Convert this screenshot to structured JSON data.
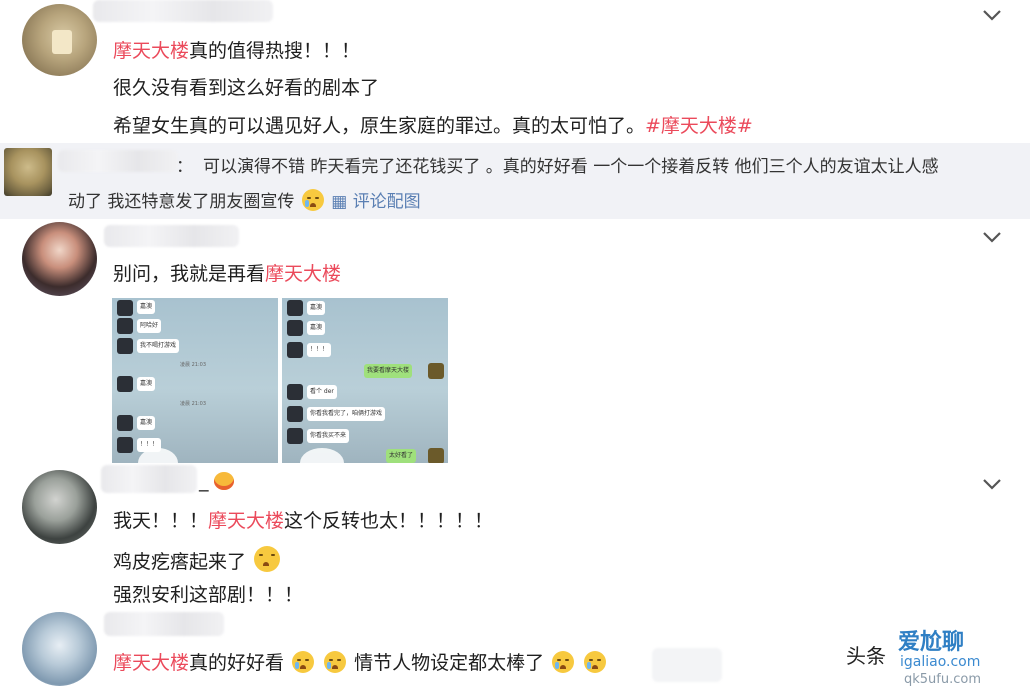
{
  "comments": [
    {
      "highlight": "摩天大楼",
      "line1_rest": "真的值得热搜！！！",
      "line2": "很久没有看到这么好看的剧本了",
      "line3_pre": "希望女生真的可以遇见好人，原生家庭的罪过。真的太可怕了。",
      "hashtag": "#摩天大楼#"
    },
    {
      "line1_pre": "别问，我就是再看",
      "highlight": "摩天大楼"
    },
    {
      "line1_pre": "我天！！！",
      "highlight": "摩天大楼",
      "line1_rest": "这个反转也太！！！！！",
      "line2": "鸡皮疙瘩起来了",
      "line3": "强烈安利这部剧！！！",
      "name_suffix": "_"
    },
    {
      "highlight": "摩天大楼",
      "line1_a": "真的好好看",
      "line1_b": "情节人物设定都太棒了"
    }
  ],
  "reply": {
    "colon": "：",
    "line1": "可以演得不错 昨天看完了还花钱买了 。真的好好看 一个一个接着反转 他们三个人的友谊太让人感",
    "line2": "动了 我还特意发了朋友圈宣传",
    "link": "评论配图"
  },
  "screenshots": {
    "left": {
      "bubbles": [
        "嘉澳",
        "阿哈好",
        "我不喝打游戏",
        "嘉澳",
        "嘉澳",
        "！！！"
      ],
      "times": [
        "凌晨 21:03",
        "凌晨 21:03"
      ]
    },
    "right": {
      "bubbles": [
        "嘉澳",
        "嘉澳",
        "！！！",
        "我要看摩天大楼",
        "看个 der",
        "你看我看完了，咱俩打游戏",
        "你看我买不来",
        "太好看了"
      ]
    }
  },
  "watermark": {
    "left": "头条",
    "brand": "爱尬聊",
    "url": "igaliao.com",
    "url2": "qk5ufu.com"
  },
  "colors": {
    "highlight": "#eb4a5b",
    "link": "#5a7fb3",
    "reply_bg": "#f1f2f6"
  }
}
